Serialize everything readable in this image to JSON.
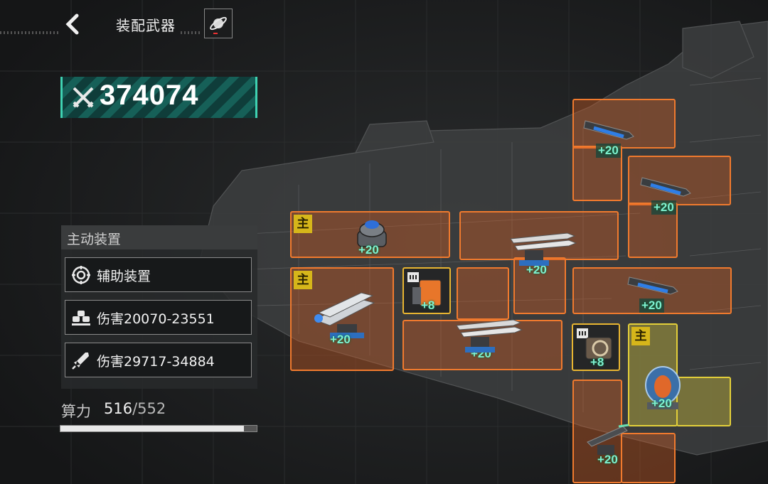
{
  "header": {
    "title": "装配武器",
    "back_icon": "chevron-left-icon",
    "planet_icon": "planet-icon"
  },
  "combat_power": {
    "value": "374074",
    "icon": "crossed-swords-icon"
  },
  "panel": {
    "heading": "主动装置",
    "items": [
      {
        "label": "辅助装置",
        "icon": "target-gear-icon"
      },
      {
        "label": "伤害20070-23551",
        "icon": "turret-cluster-icon"
      },
      {
        "label": "伤害29717-34884",
        "icon": "missile-icon"
      }
    ]
  },
  "compute": {
    "label": "算力",
    "used": "516",
    "separator": "/",
    "max": "552",
    "fill_fraction": 0.935
  },
  "slots": {
    "main_badge": "主",
    "bonus_20": "+20",
    "bonus_8": "+8"
  },
  "colors": {
    "slot_orange": "#f07a2e",
    "slot_yellow": "#e3cf3a",
    "power_teal": "#3fd2b2",
    "bonus_text": "#7ff0d0"
  }
}
